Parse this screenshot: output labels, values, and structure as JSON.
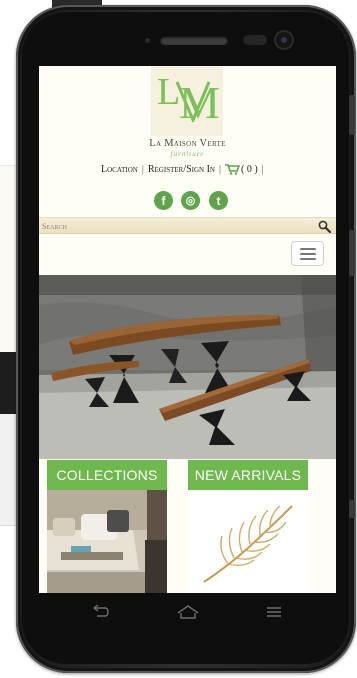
{
  "brand": {
    "monogram_l": "L",
    "monogram_mv": "M",
    "name": "La Maison Verte",
    "tagline": "furniture",
    "accent_color": "#6fb84e"
  },
  "top_links": {
    "location": "Location",
    "register": "Register/Sign In",
    "cart_count": "( 0 )"
  },
  "social": [
    {
      "icon": "facebook-icon",
      "glyph": "f"
    },
    {
      "icon": "instagram-icon",
      "glyph": "◎"
    },
    {
      "icon": "twitter-icon",
      "glyph": "t"
    }
  ],
  "search": {
    "placeholder": "Search"
  },
  "sections": {
    "collections": "COLLECTIONS",
    "new_arrivals": "NEW ARRIVALS"
  },
  "icons": {
    "menu": "hamburger-menu-icon",
    "cart": "cart-icon",
    "search": "search-icon",
    "nav": [
      "back-icon",
      "home-icon",
      "recent-apps-icon"
    ]
  }
}
